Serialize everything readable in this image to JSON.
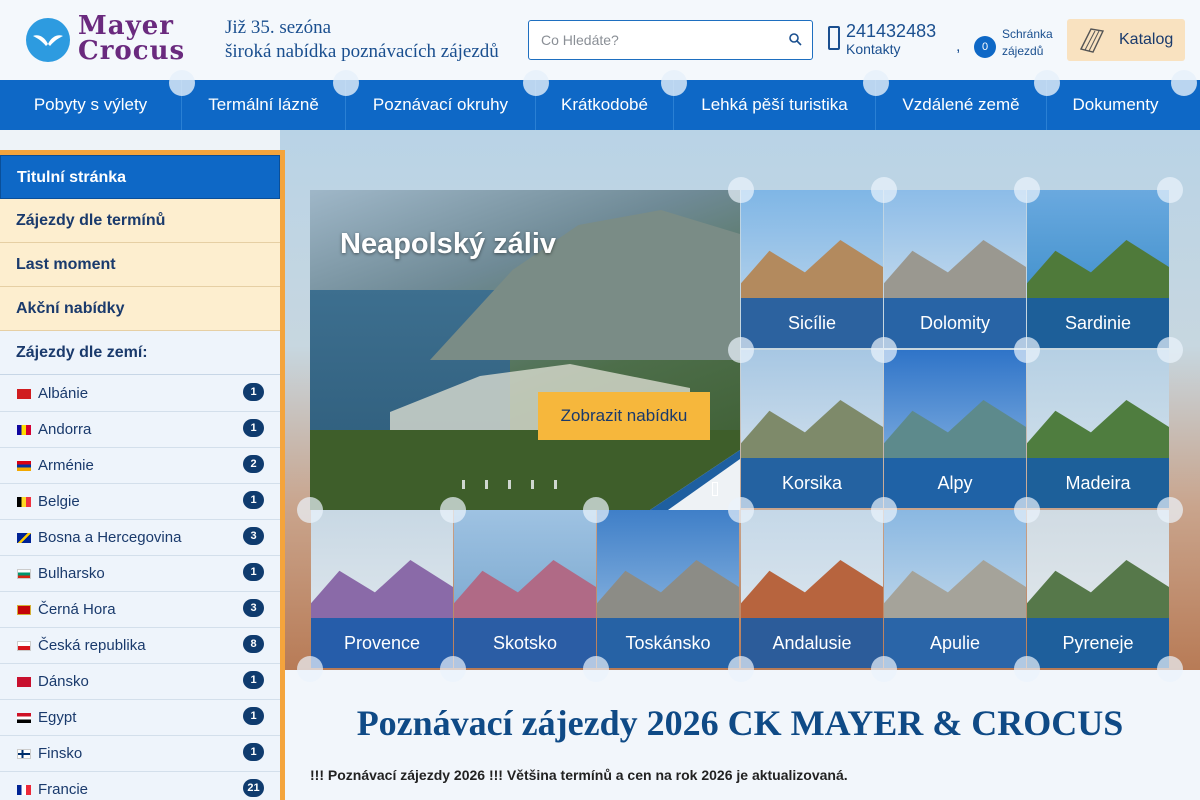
{
  "brand": {
    "logo_line1": "Mayer",
    "logo_line2": "Crocus",
    "tagline_line1": "Již 35. sezóna",
    "tagline_line2": "široká nabídka poznávacích zájezdů"
  },
  "search": {
    "placeholder": "Co Hledáte?",
    "icon": "search-icon"
  },
  "contact": {
    "phone": "241432483",
    "label": "Kontakty",
    "icon": "phone-icon"
  },
  "cart": {
    "separator": ",",
    "count": "0",
    "label_line1": "Schránka",
    "label_line2": "zájezdů"
  },
  "catalog": {
    "label": "Katalog",
    "icon": "book-icon"
  },
  "nav": {
    "items": [
      {
        "label": "Pobyty s výlety"
      },
      {
        "label": "Termální lázně"
      },
      {
        "label": "Poznávací okruhy"
      },
      {
        "label": "Krátkodobé"
      },
      {
        "label": "Lehká pěší turistika"
      },
      {
        "label": "Vzdálené země"
      },
      {
        "label": "Dokumenty"
      }
    ]
  },
  "sidebar": {
    "links": [
      {
        "label": "Titulní stránka"
      },
      {
        "label": "Zájezdy dle termínů"
      },
      {
        "label": "Last moment"
      },
      {
        "label": "Akční nabídky"
      }
    ],
    "countries_heading": "Zájezdy dle zemí:",
    "countries": [
      {
        "name": "Albánie",
        "count": "1"
      },
      {
        "name": "Andorra",
        "count": "1"
      },
      {
        "name": "Arménie",
        "count": "2"
      },
      {
        "name": "Belgie",
        "count": "1"
      },
      {
        "name": "Bosna a Hercegovina",
        "count": "3"
      },
      {
        "name": "Bulharsko",
        "count": "1"
      },
      {
        "name": "Černá Hora",
        "count": "3"
      },
      {
        "name": "Česká republika",
        "count": "8"
      },
      {
        "name": "Dánsko",
        "count": "1"
      },
      {
        "name": "Egypt",
        "count": "1"
      },
      {
        "name": "Finsko",
        "count": "1"
      },
      {
        "name": "Francie",
        "count": "21"
      }
    ]
  },
  "hero": {
    "title": "Neapolský záliv",
    "button": "Zobrazit nabídku"
  },
  "tiles": [
    {
      "label": "Sicílie"
    },
    {
      "label": "Dolomity"
    },
    {
      "label": "Sardinie"
    },
    {
      "label": "Korsika"
    },
    {
      "label": "Alpy"
    },
    {
      "label": "Madeira"
    },
    {
      "label": "Provence"
    },
    {
      "label": "Skotsko"
    },
    {
      "label": "Toskánsko"
    },
    {
      "label": "Andalusie"
    },
    {
      "label": "Apulie"
    },
    {
      "label": "Pyreneje"
    }
  ],
  "main": {
    "title": "Poznávací zájezdy 2026 CK MAYER & CROCUS",
    "note": "!!! Poznávací zájezdy 2026 !!! Většina termínů a cen na rok 2026 je aktualizovaná."
  },
  "colors": {
    "primary_blue": "#0e68c6",
    "brand_purple": "#6a2a7e",
    "accent_orange": "#f4a43c",
    "button_yellow": "#f6b73c"
  }
}
